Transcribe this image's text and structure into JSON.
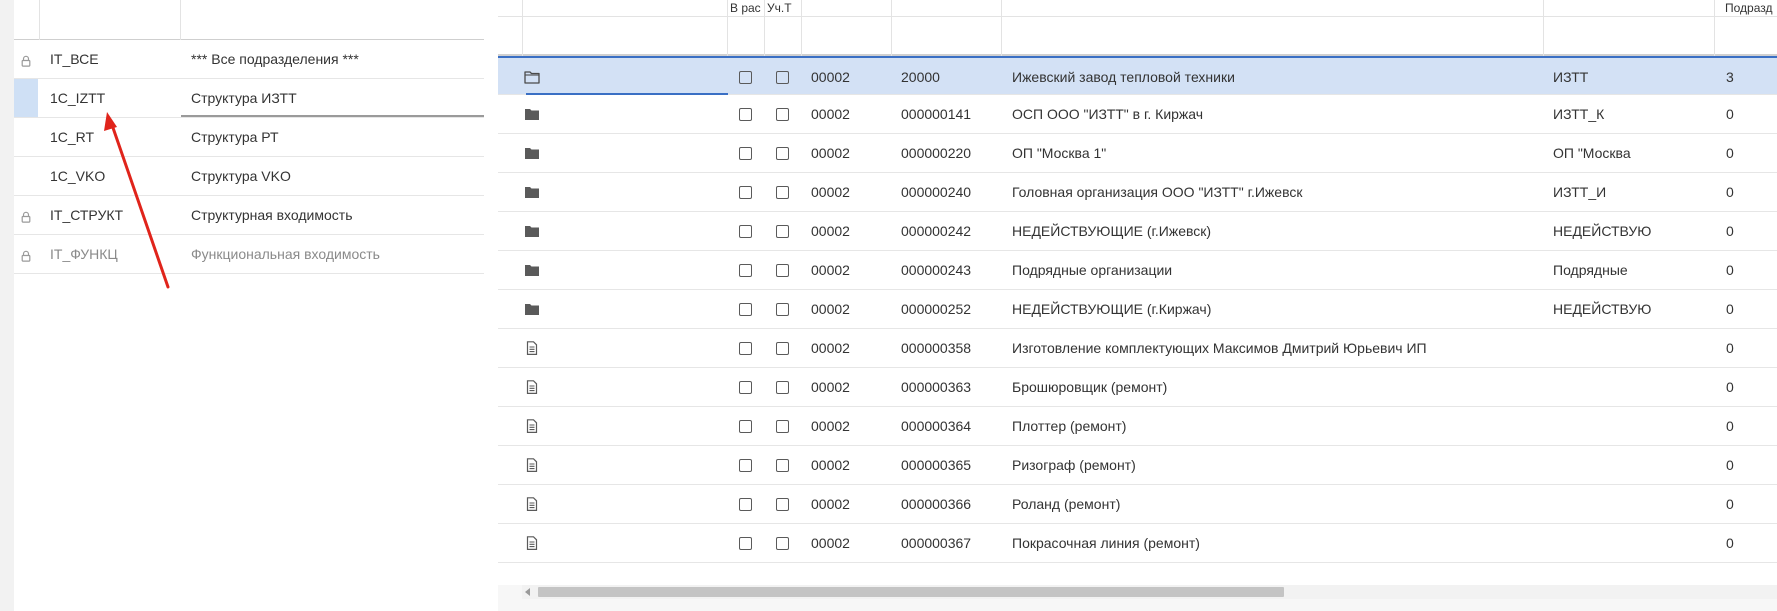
{
  "left_table": {
    "rows": [
      {
        "code": "IT_ВСЕ",
        "name": "*** Все подразделения ***",
        "locked": true,
        "disabled": false,
        "current": false
      },
      {
        "code": "1C_IZTT",
        "name": "Структура ИЗТТ",
        "locked": false,
        "disabled": false,
        "current": true
      },
      {
        "code": "1C_RT",
        "name": "Структура РТ",
        "locked": false,
        "disabled": false,
        "current": false
      },
      {
        "code": "1C_VKO",
        "name": "Структура VKO",
        "locked": false,
        "disabled": false,
        "current": false
      },
      {
        "code": "IT_СТРУКТ",
        "name": "Структурная входимость",
        "locked": true,
        "disabled": false,
        "current": false
      },
      {
        "code": "IT_ФУНКЦ",
        "name": "Функциональная входимость",
        "locked": true,
        "disabled": true,
        "current": false
      }
    ]
  },
  "grid": {
    "headers": {
      "col_in_calc": "В рас",
      "col_uch": "Уч.Т",
      "col_sub": "Подразд"
    },
    "rows": [
      {
        "icon": "folder-open-icon",
        "org": "00002",
        "code": "20000",
        "name": "Ижевский завод тепловой техники",
        "short": "ИЗТТ",
        "sub": "3",
        "selected": true
      },
      {
        "icon": "folder-icon",
        "org": "00002",
        "code": "000000141",
        "name": "ОСП ООО \"ИЗТТ\" в г. Киржач",
        "short": "ИЗТТ_К",
        "sub": "0",
        "selected": false
      },
      {
        "icon": "folder-icon",
        "org": "00002",
        "code": "000000220",
        "name": "ОП \"Москва 1\"",
        "short": "ОП \"Москва",
        "sub": "0",
        "selected": false
      },
      {
        "icon": "folder-icon",
        "org": "00002",
        "code": "000000240",
        "name": "Головная организация ООО \"ИЗТТ\" г.Ижевск",
        "short": "ИЗТТ_И",
        "sub": "0",
        "selected": false
      },
      {
        "icon": "folder-icon",
        "org": "00002",
        "code": "000000242",
        "name": "НЕДЕЙСТВУЮЩИЕ (г.Ижевск)",
        "short": "НЕДЕЙСТВУЮ",
        "sub": "0",
        "selected": false
      },
      {
        "icon": "folder-icon",
        "org": "00002",
        "code": "000000243",
        "name": "Подрядные организации",
        "short": "Подрядные",
        "sub": "0",
        "selected": false
      },
      {
        "icon": "folder-icon",
        "org": "00002",
        "code": "000000252",
        "name": "НЕДЕЙСТВУЮЩИЕ (г.Киржач)",
        "short": "НЕДЕЙСТВУЮ",
        "sub": "0",
        "selected": false
      },
      {
        "icon": "document-icon",
        "org": "00002",
        "code": "000000358",
        "name": "Изготовление комплектующих Максимов Дмитрий Юрьевич ИП",
        "short": "",
        "sub": "0",
        "selected": false
      },
      {
        "icon": "document-icon",
        "org": "00002",
        "code": "000000363",
        "name": "Брошюровщик (ремонт)",
        "short": "",
        "sub": "0",
        "selected": false
      },
      {
        "icon": "document-icon",
        "org": "00002",
        "code": "000000364",
        "name": "Плоттер (ремонт)",
        "short": "",
        "sub": "0",
        "selected": false
      },
      {
        "icon": "document-icon",
        "org": "00002",
        "code": "000000365",
        "name": "Ризограф (ремонт)",
        "short": "",
        "sub": "0",
        "selected": false
      },
      {
        "icon": "document-icon",
        "org": "00002",
        "code": "000000366",
        "name": "Роланд (ремонт)",
        "short": "",
        "sub": "0",
        "selected": false
      },
      {
        "icon": "document-icon",
        "org": "00002",
        "code": "000000367",
        "name": "Покрасочная линия (ремонт)",
        "short": "",
        "sub": "0",
        "selected": false
      }
    ]
  },
  "colors": {
    "selection": "#d3e1f5",
    "selection_border": "#3a6fc4",
    "annotation_arrow": "#e0241b"
  }
}
